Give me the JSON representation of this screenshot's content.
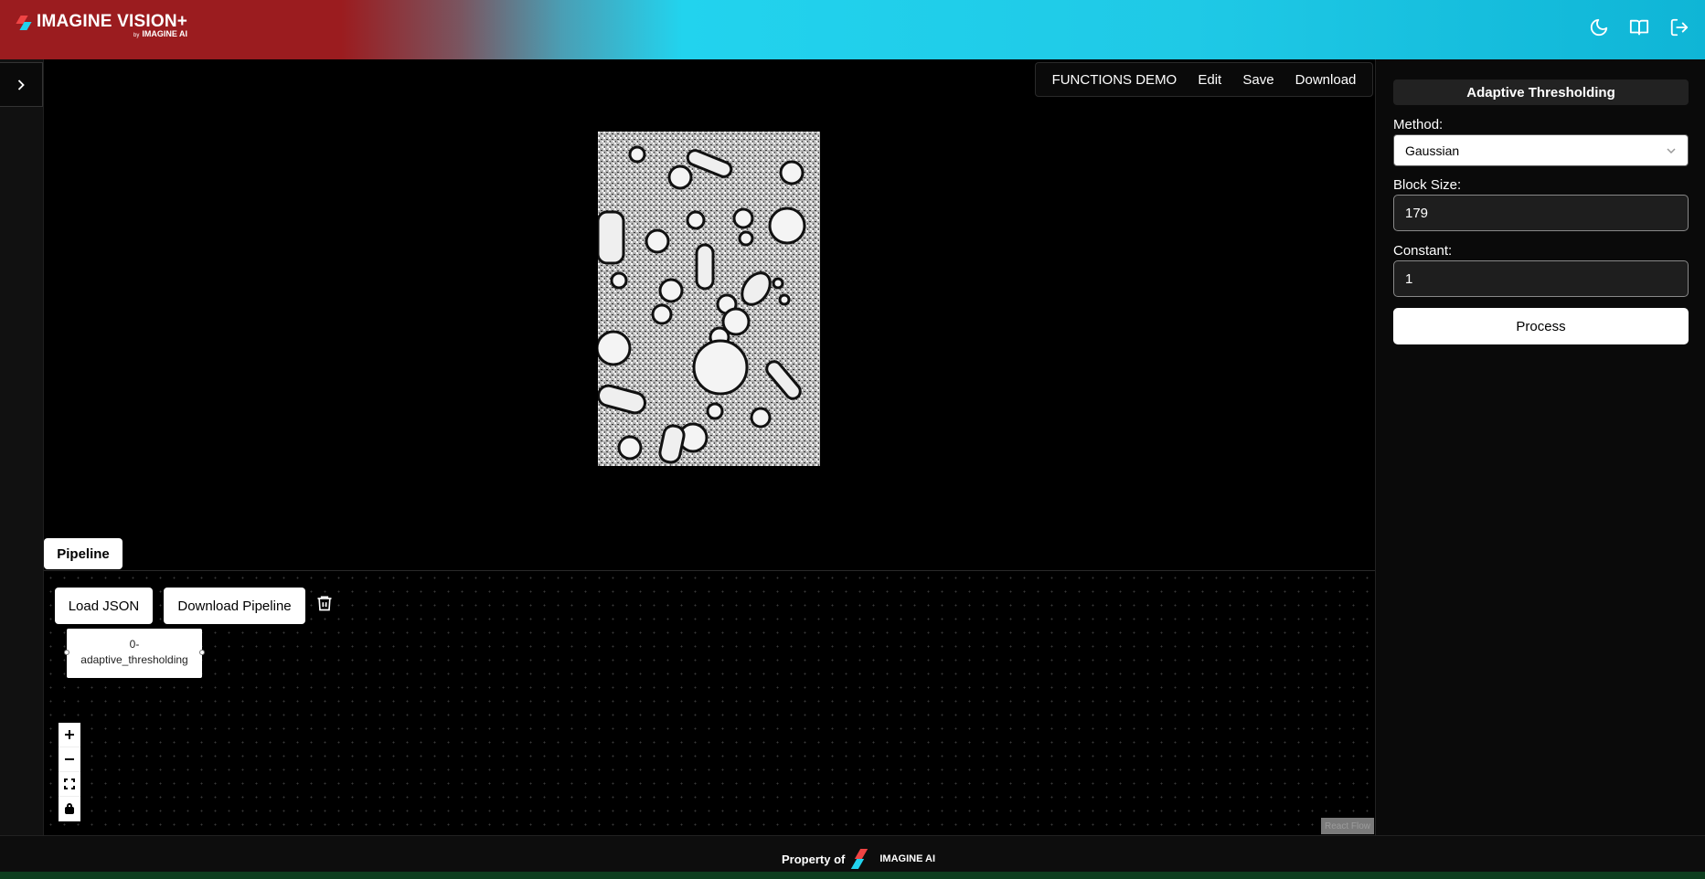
{
  "header": {
    "brand_main": "IMAGINE VISION+",
    "brand_by": "by",
    "brand_sub": "IMAGINE AI",
    "icons": [
      "moon-icon",
      "book-icon",
      "logout-icon"
    ]
  },
  "sidebar": {
    "toggle_icon": "chevron-right-icon"
  },
  "menu": {
    "items": [
      "FUNCTIONS DEMO",
      "Edit",
      "Save",
      "Download"
    ]
  },
  "preview": {
    "description_icon": "processed-image"
  },
  "pipeline": {
    "tab_label": "Pipeline",
    "load_json": "Load JSON",
    "download_pipeline": "Download Pipeline",
    "node_label": "0-\nadaptive_thresholding",
    "node_line1": "0-",
    "node_line2": "adaptive_thresholding",
    "controls": [
      "plus-icon",
      "minus-icon",
      "fit-view-icon",
      "lock-icon"
    ],
    "attribution": "React Flow"
  },
  "panel": {
    "title": "Adaptive Thresholding",
    "method_label": "Method:",
    "method_value": "Gaussian",
    "block_size_label": "Block Size:",
    "block_size_value": "179",
    "constant_label": "Constant:",
    "constant_value": "1",
    "process_label": "Process"
  },
  "footer": {
    "property_of": "Property of",
    "brand": "IMAGINE AI"
  },
  "colors": {
    "header_red": "#9b1c1f",
    "header_cyan": "#22d3ee",
    "accent_red": "#ef4444"
  }
}
